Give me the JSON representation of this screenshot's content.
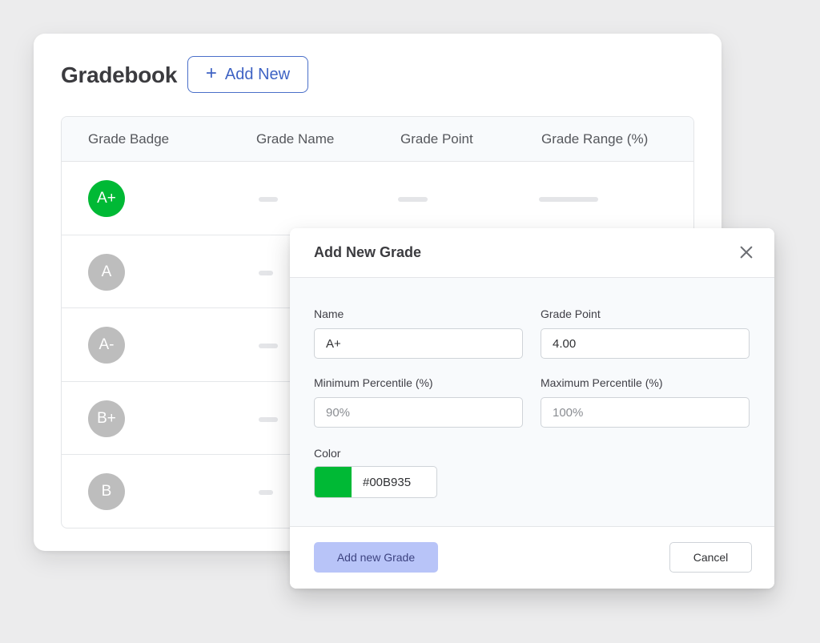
{
  "gradebook": {
    "title": "Gradebook",
    "add_new_icon": "plus-icon",
    "add_new_label": "Add New",
    "columns": [
      "Grade Badge",
      "Grade Name",
      "Grade Point",
      "Grade Range (%)"
    ],
    "rows": [
      {
        "badge": "A+",
        "color": "#00B935"
      },
      {
        "badge": "A",
        "color": "#bdbdbd"
      },
      {
        "badge": "A-",
        "color": "#bdbdbd"
      },
      {
        "badge": "B+",
        "color": "#bdbdbd"
      },
      {
        "badge": "B",
        "color": "#bdbdbd"
      }
    ]
  },
  "modal": {
    "title": "Add New Grade",
    "close_icon": "close-icon",
    "fields": {
      "name": {
        "label": "Name",
        "value": "A+"
      },
      "grade_point": {
        "label": "Grade Point",
        "value": "4.00"
      },
      "min_percentile": {
        "label": "Minimum Percentile (%)",
        "placeholder": "90%"
      },
      "max_percentile": {
        "label": "Maximum Percentile (%)",
        "placeholder": "100%"
      },
      "color": {
        "label": "Color",
        "value": "#00B935"
      }
    },
    "submit_label": "Add new Grade",
    "cancel_label": "Cancel"
  }
}
